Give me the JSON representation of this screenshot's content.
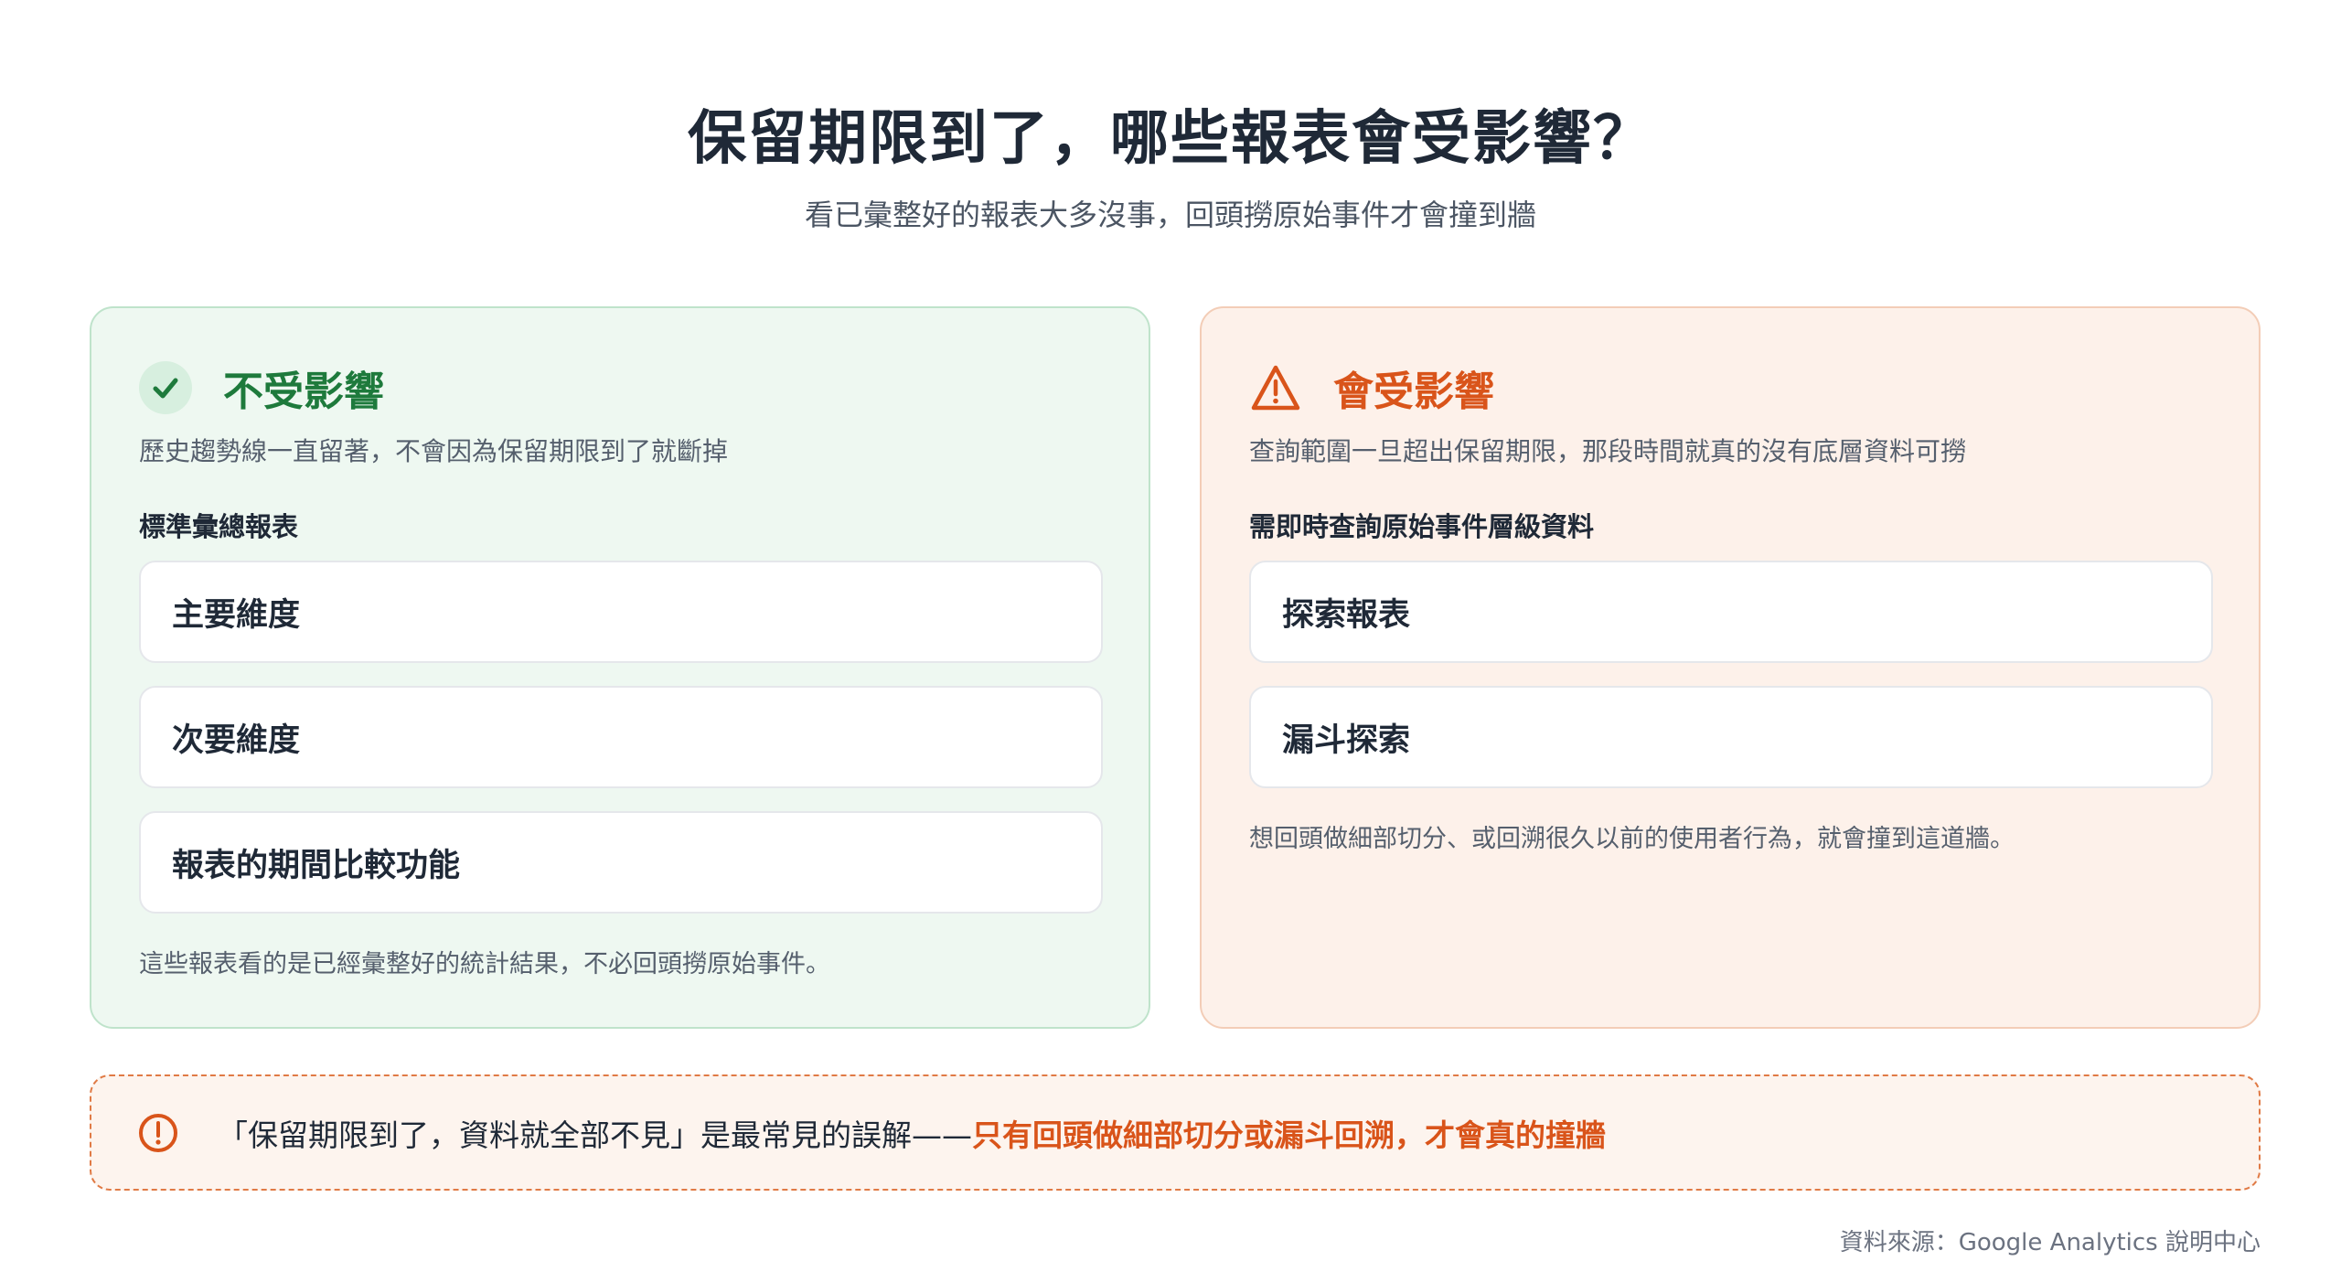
{
  "header": {
    "title": "保留期限到了，哪些報表會受影響？",
    "subtitle": "看已彙整好的報表大多沒事，回頭撈原始事件才會撞到牆"
  },
  "unaffected": {
    "icon": "check-icon",
    "title": "不受影響",
    "description": "歷史趨勢線一直留著，不會因為保留期限到了就斷掉",
    "subtitle": "標準彙總報表",
    "items": [
      "主要維度",
      "次要維度",
      "報表的期間比較功能"
    ],
    "note": "這些報表看的是已經彙整好的統計結果，不必回頭撈原始事件。",
    "accent_color": "#1e7a3c"
  },
  "affected": {
    "icon": "warning-icon",
    "title": "會受影響",
    "description": "查詢範圍一旦超出保留期限，那段時間就真的沒有底層資料可撈",
    "subtitle": "需即時查詢原始事件層級資料",
    "items": [
      "探索報表",
      "漏斗探索"
    ],
    "note": "想回頭做細部切分、或回溯很久以前的使用者行為，就會撞到這道牆。",
    "accent_color": "#d9541a"
  },
  "callout": {
    "icon": "alert-circle-icon",
    "text": "「保留期限到了，資料就全部不見」是最常見的誤解——",
    "emphasis": "只有回頭做細部切分或漏斗回溯，才會真的撞牆"
  },
  "footer": {
    "source": "資料來源：Google Analytics 說明中心"
  }
}
